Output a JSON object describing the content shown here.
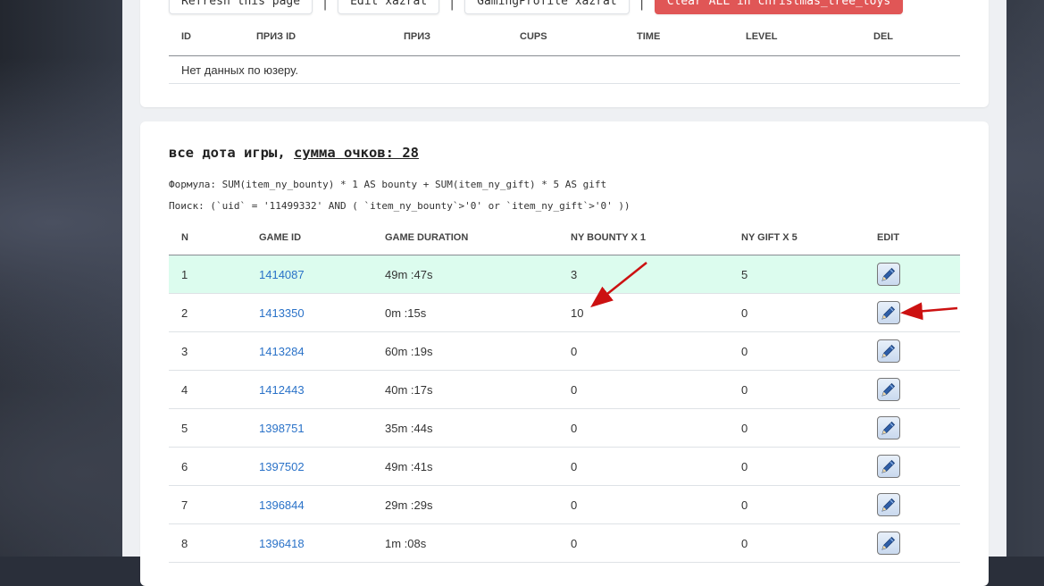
{
  "toolbar": {
    "refresh": "Refresh this page",
    "edit": "Edit xazrat",
    "gaming_profile": "GamingProfile xazrat",
    "clear_all": "Clear ALL in christmas_tree_toys",
    "separator": "|"
  },
  "prizes_table": {
    "headers": [
      "ID",
      "ПРИЗ ID",
      "ПРИЗ",
      "CUPS",
      "TIME",
      "LEVEL",
      "DEL"
    ],
    "empty_text": "Нет данных по юзеру."
  },
  "games": {
    "title_prefix": "все дота игры,",
    "sum_label": "сумма очков: 28",
    "formula": "Формула: SUM(item_ny_bounty) * 1 AS bounty + SUM(item_ny_gift) * 5 AS gift",
    "search": "Поиск: (`uid` = '11499332' AND ( `item_ny_bounty`>'0' or `item_ny_gift`>'0' ))",
    "headers": [
      "N",
      "GAME ID",
      "GAME DURATION",
      "NY BOUNTY X 1",
      "NY GIFT X 5",
      "EDIT"
    ],
    "rows": [
      {
        "n": "1",
        "game_id": "1414087",
        "duration": "49m :47s",
        "bounty": "3",
        "gift": "5"
      },
      {
        "n": "2",
        "game_id": "1413350",
        "duration": "0m :15s",
        "bounty": "10",
        "gift": "0"
      },
      {
        "n": "3",
        "game_id": "1413284",
        "duration": "60m :19s",
        "bounty": "0",
        "gift": "0"
      },
      {
        "n": "4",
        "game_id": "1412443",
        "duration": "40m :17s",
        "bounty": "0",
        "gift": "0"
      },
      {
        "n": "5",
        "game_id": "1398751",
        "duration": "35m :44s",
        "bounty": "0",
        "gift": "0"
      },
      {
        "n": "6",
        "game_id": "1397502",
        "duration": "49m :41s",
        "bounty": "0",
        "gift": "0"
      },
      {
        "n": "7",
        "game_id": "1396844",
        "duration": "29m :29s",
        "bounty": "0",
        "gift": "0"
      },
      {
        "n": "8",
        "game_id": "1396418",
        "duration": "1m :08s",
        "bounty": "0",
        "gift": "0"
      }
    ]
  },
  "icons": {
    "edit": "pencil-icon"
  },
  "colors": {
    "highlight_row": "#dcfcee",
    "link": "#2a72c8",
    "danger": "#e05656",
    "annotation_arrow": "#cc1111"
  }
}
